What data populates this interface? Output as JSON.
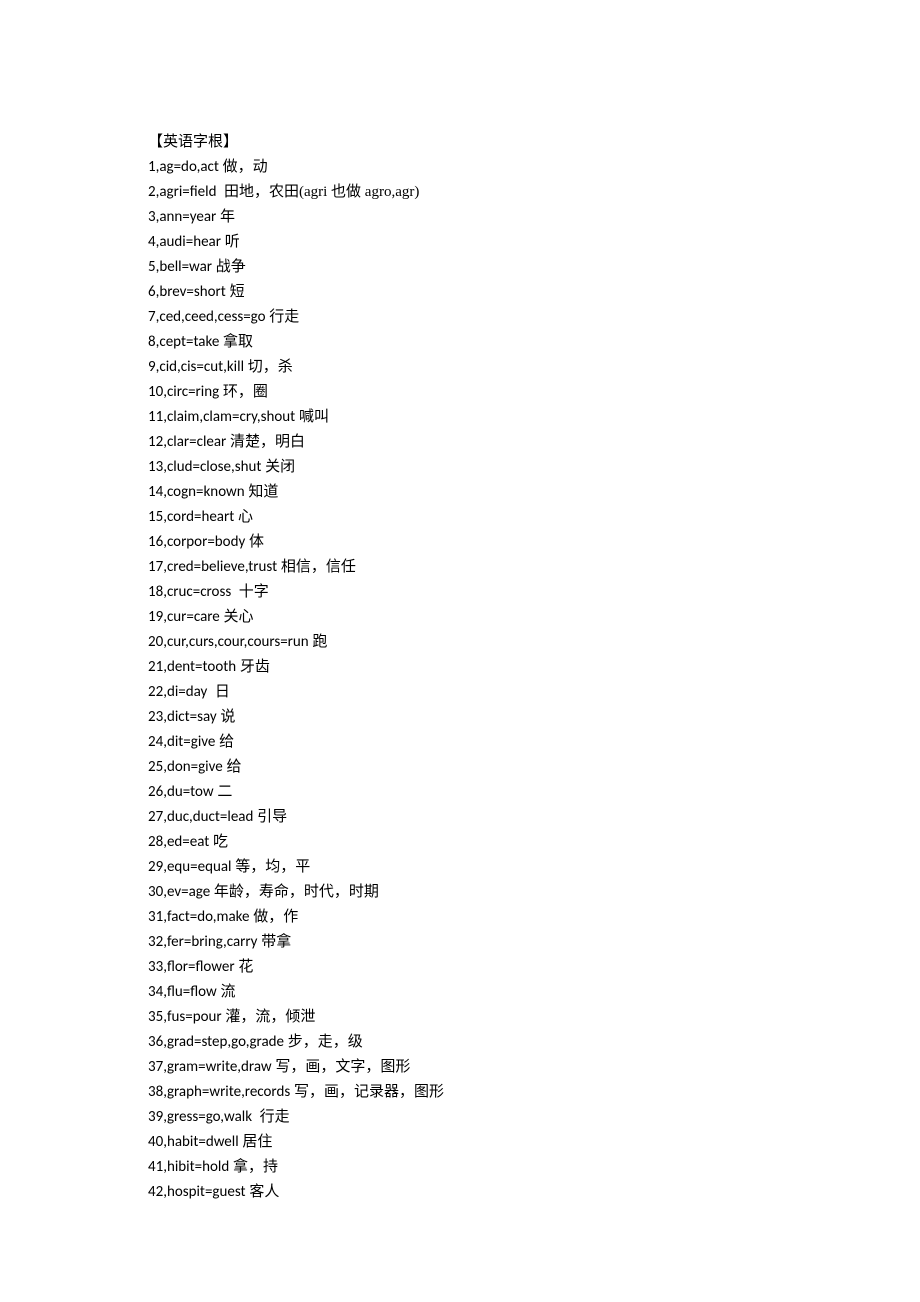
{
  "title": "【英语字根】",
  "entries": [
    {
      "n": "1",
      "root": "ag",
      "eq": "do,act",
      "zh": " 做，动"
    },
    {
      "n": "2",
      "root": "agri",
      "eq": "field",
      "zh": "  田地，农田(agri 也做 agro,agr)"
    },
    {
      "n": "3",
      "root": "ann",
      "eq": "year",
      "zh": " 年"
    },
    {
      "n": "4",
      "root": "audi",
      "eq": "hear",
      "zh": " 听"
    },
    {
      "n": "5",
      "root": "bell",
      "eq": "war",
      "zh": " 战争"
    },
    {
      "n": "6",
      "root": "brev",
      "eq": "short",
      "zh": " 短"
    },
    {
      "n": "7",
      "root": "ced,ceed,cess",
      "eq": "go",
      "zh": " 行走"
    },
    {
      "n": "8",
      "root": "cept",
      "eq": "take",
      "zh": " 拿取"
    },
    {
      "n": "9",
      "root": "cid,cis",
      "eq": "cut,kill",
      "zh": " 切，杀"
    },
    {
      "n": "10",
      "root": "circ",
      "eq": "ring",
      "zh": " 环，圈"
    },
    {
      "n": "11",
      "root": "claim,clam",
      "eq": "cry,shout",
      "zh": " 喊叫"
    },
    {
      "n": "12",
      "root": "clar",
      "eq": "clear",
      "zh": " 清楚，明白"
    },
    {
      "n": "13",
      "root": "clud",
      "eq": "close,shut",
      "zh": " 关闭"
    },
    {
      "n": "14",
      "root": "cogn",
      "eq": "known",
      "zh": " 知道"
    },
    {
      "n": "15",
      "root": "cord",
      "eq": "heart",
      "zh": " 心"
    },
    {
      "n": "16",
      "root": "corpor",
      "eq": "body",
      "zh": " 体"
    },
    {
      "n": "17",
      "root": "cred",
      "eq": "believe,trust",
      "zh": " 相信，信任"
    },
    {
      "n": "18",
      "root": "cruc",
      "eq": "cross",
      "zh": "  十字"
    },
    {
      "n": "19",
      "root": "cur",
      "eq": "care",
      "zh": " 关心"
    },
    {
      "n": "20",
      "root": "cur,curs,cour,cours",
      "eq": "run",
      "zh": " 跑"
    },
    {
      "n": "21",
      "root": "dent",
      "eq": "tooth",
      "zh": " 牙齿"
    },
    {
      "n": "22",
      "root": "di",
      "eq": "day",
      "zh": "  日"
    },
    {
      "n": "23",
      "root": "dict",
      "eq": "say",
      "zh": " 说"
    },
    {
      "n": "24",
      "root": "dit",
      "eq": "give",
      "zh": " 给"
    },
    {
      "n": "25",
      "root": "don",
      "eq": "give",
      "zh": " 给"
    },
    {
      "n": "26",
      "root": "du",
      "eq": "tow",
      "zh": " 二"
    },
    {
      "n": "27",
      "root": "duc,duct",
      "eq": "lead",
      "zh": " 引导"
    },
    {
      "n": "28",
      "root": "ed",
      "eq": "eat",
      "zh": " 吃"
    },
    {
      "n": "29",
      "root": "equ",
      "eq": "equal",
      "zh": " 等，均，平"
    },
    {
      "n": "30",
      "root": "ev",
      "eq": "age",
      "zh": " 年龄，寿命，时代，时期"
    },
    {
      "n": "31",
      "root": "fact",
      "eq": "do,make",
      "zh": " 做，作"
    },
    {
      "n": "32",
      "root": "fer",
      "eq": "bring,carry",
      "zh": " 带拿"
    },
    {
      "n": "33",
      "root": "flor",
      "eq": "flower",
      "zh": " 花"
    },
    {
      "n": "34",
      "root": "flu",
      "eq": "flow",
      "zh": " 流"
    },
    {
      "n": "35",
      "root": "fus",
      "eq": "pour",
      "zh": " 灌，流，倾泄"
    },
    {
      "n": "36",
      "root": "grad",
      "eq": "step,go,grade",
      "zh": " 步，走，级"
    },
    {
      "n": "37",
      "root": "gram",
      "eq": "write,draw",
      "zh": " 写，画，文字，图形"
    },
    {
      "n": "38",
      "root": "graph",
      "eq": "write,records",
      "zh": " 写，画，记录器，图形"
    },
    {
      "n": "39",
      "root": "gress",
      "eq": "go,walk",
      "zh": "  行走"
    },
    {
      "n": "40",
      "root": "habit",
      "eq": "dwell",
      "zh": " 居住"
    },
    {
      "n": "41",
      "root": "hibit",
      "eq": "hold",
      "zh": " 拿，持"
    },
    {
      "n": "42",
      "root": "hospit",
      "eq": "guest",
      "zh": " 客人"
    }
  ]
}
